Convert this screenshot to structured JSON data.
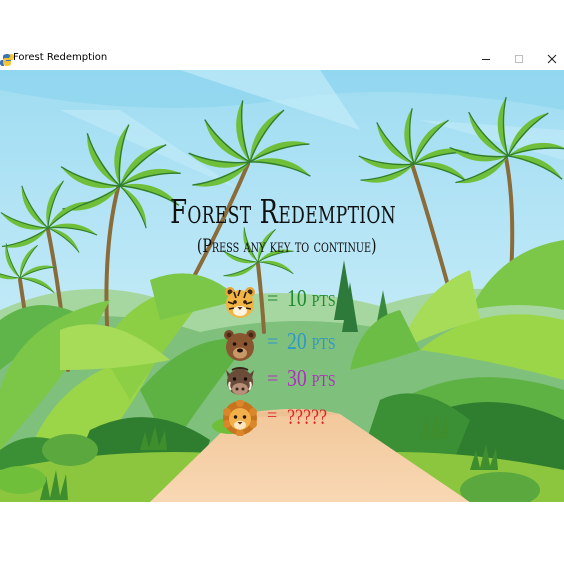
{
  "window": {
    "title": "Forest Redemption",
    "controls": {
      "minimize": "minimize",
      "maximize": "maximize",
      "close": "close"
    }
  },
  "game": {
    "title": "Forest Redemption",
    "subtitle": "(Press any key to continue)",
    "legend": [
      {
        "animal": "tiger",
        "icon": "tiger-icon",
        "equals": "=",
        "points": "10 pts",
        "color": "#1f8a2e"
      },
      {
        "animal": "bear",
        "icon": "bear-icon",
        "equals": "=",
        "points": "20 pts",
        "color": "#2f98c8"
      },
      {
        "animal": "boar",
        "icon": "boar-icon",
        "equals": "=",
        "points": "30 pts",
        "color": "#b02fbf"
      },
      {
        "animal": "lion",
        "icon": "lion-icon",
        "equals": "=",
        "points": "?????",
        "color": "#e0252a"
      }
    ]
  },
  "colors": {
    "sky": "#bfe9f7",
    "grass": "#8cc63e",
    "path": "#f6d2a6",
    "foliage_dark": "#2f7d2e",
    "foliage_light": "#9ad648"
  }
}
